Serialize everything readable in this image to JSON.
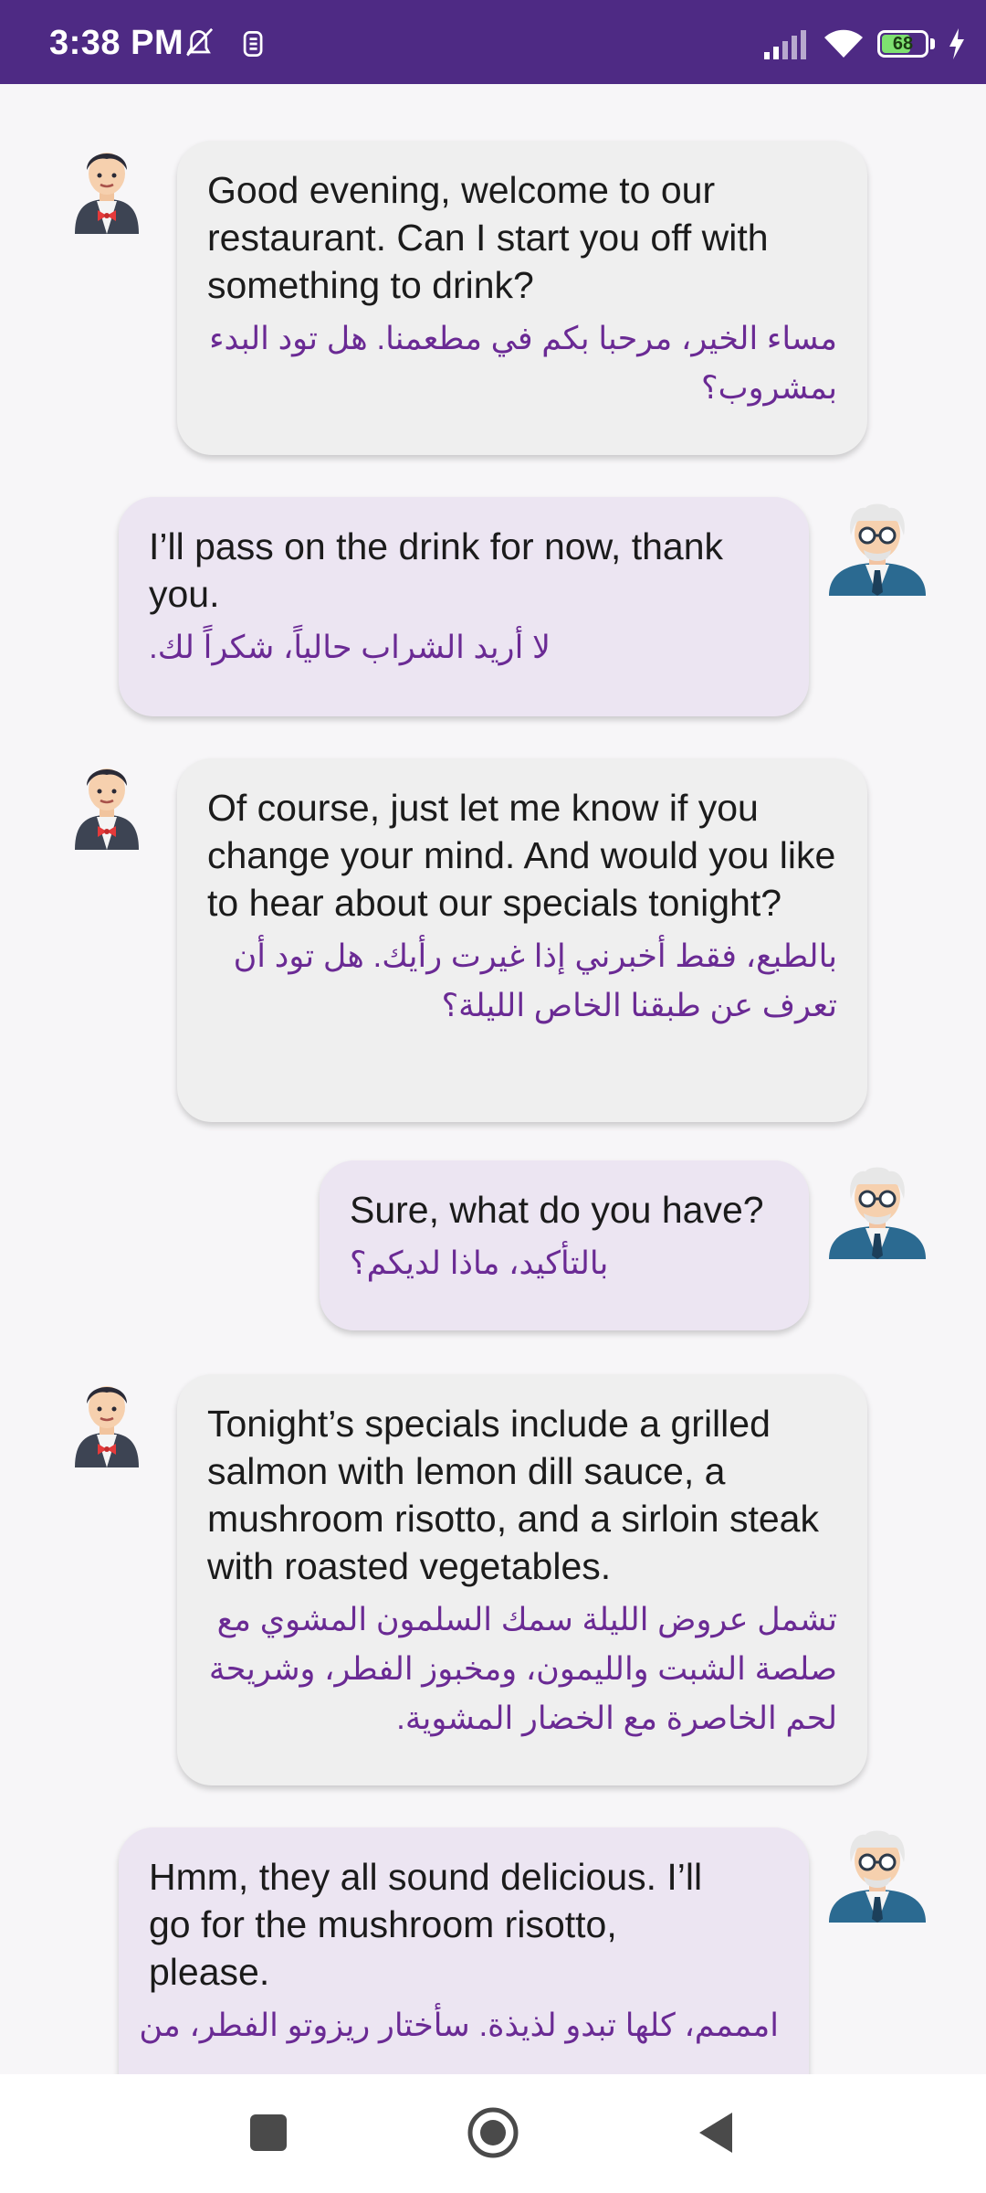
{
  "status_bar": {
    "time": "3:38 PM",
    "battery_level": "68",
    "battery_fraction": 0.68,
    "colors": {
      "background": "#4e2a84",
      "battery": "#7ee070"
    },
    "icons": [
      "mute-icon",
      "sync-icon",
      "signal-icon",
      "wifi-icon",
      "battery-icon",
      "charging-icon"
    ]
  },
  "conversation": [
    {
      "speaker": "waiter",
      "en": "Good evening, welcome to our restaurant. Can I start you off with something to drink?",
      "ar": "مساء الخير، مرحبا بكم في مطعمنا. هل تود البدء بمشروب؟"
    },
    {
      "speaker": "customer",
      "en": "I’ll pass on the drink for now, thank you.",
      "ar": "لا أريد الشراب حالياً، شكراً لك."
    },
    {
      "speaker": "waiter",
      "en": "Of course, just let me know if you change your mind. And would you like to hear about our specials tonight?",
      "ar": "بالطبع، فقط أخبرني إذا غيرت رأيك. هل تود أن تعرف عن طبقنا الخاص الليلة؟"
    },
    {
      "speaker": "customer",
      "en": "Sure, what do you have?",
      "ar": "بالتأكيد، ماذا لديكم؟"
    },
    {
      "speaker": "waiter",
      "en": "Tonight’s specials include a grilled salmon with lemon dill sauce, a mushroom risotto, and a sirloin steak with roasted vegetables.",
      "ar": "تشمل عروض الليلة سمك السلمون المشوي مع صلصة الشبت والليمون، ومخبوز الفطر، وشريحة لحم الخاصرة مع الخضار المشوية."
    },
    {
      "speaker": "customer",
      "en": "Hmm, they all sound delicious. I’ll go for the mushroom risotto, please.",
      "ar": "امممم، كلها تبدو لذيذة. سأختار ريزوتو الفطر، من"
    }
  ],
  "colors": {
    "waiter_bubble": "#efefef",
    "customer_bubble": "#ece5f2",
    "translation_text": "#6a2a94"
  },
  "nav_bar": {
    "buttons": [
      "recents-square-icon",
      "home-circle-icon",
      "back-triangle-icon"
    ]
  }
}
